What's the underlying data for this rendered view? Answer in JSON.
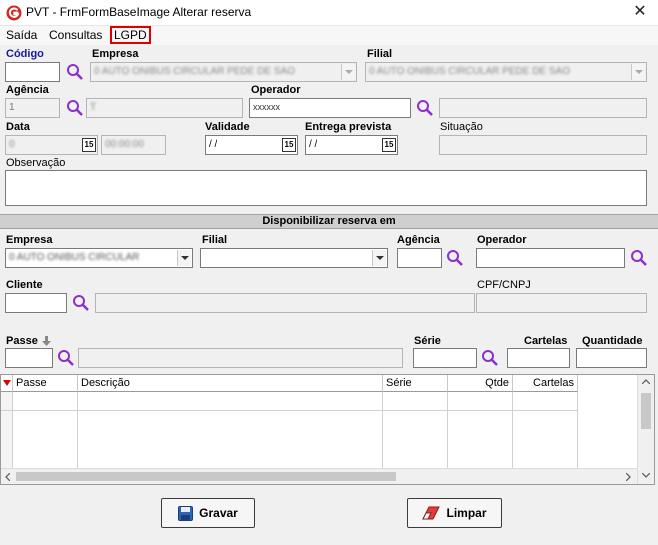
{
  "window": {
    "title": "PVT - FrmFormBaseImage Alterar reserva",
    "close_glyph": "✕"
  },
  "menu": [
    {
      "label": "Saída"
    },
    {
      "label": "Consultas"
    },
    {
      "label": "LGPD"
    }
  ],
  "top": {
    "codigo_label": "Código",
    "codigo_value": "",
    "empresa_label": "Empresa",
    "empresa_value": "0   AUTO ONIBUS CIRCULAR PEDE DE SÃO",
    "filial_label": "Filial",
    "filial_value": "0   AUTO ONIBUS CIRCULAR PEDE DE SÃO",
    "agencia_label": "Agência",
    "agencia_value": "1",
    "agencia_desc": "T",
    "operador_label": "Operador",
    "operador_value": "xxxxxx",
    "operador_desc": "",
    "data_label": "Data",
    "data_value": "0",
    "data_time": "00:00:00",
    "validade_label": "Validade",
    "validade_value": " / /",
    "entrega_label": "Entrega prevista",
    "entrega_value": " / /",
    "situacao_label": "Situação",
    "situacao_value": "",
    "observacao_label": "Observação",
    "observacao_value": ""
  },
  "disponibilizar": {
    "header": "Disponibilizar reserva em",
    "empresa_label": "Empresa",
    "empresa_value": "0   AUTO ONIBUS CIRCULAR",
    "filial_label": "Filial",
    "filial_value": "",
    "agencia_label": "Agência",
    "agencia_value": "",
    "operador_label": "Operador",
    "operador_value": "",
    "cliente_label": "Cliente",
    "cliente_value": "",
    "cliente_desc": "",
    "cpf_label": "CPF/CNPJ",
    "cpf_value": "",
    "passe_label": "Passe",
    "passe_value": "",
    "passe_desc": "",
    "serie_label": "Série",
    "serie_value": "",
    "cartelas_label": "Cartelas",
    "cartelas_value": "",
    "quantidade_label": "Quantidade",
    "quantidade_value": ""
  },
  "grid": {
    "columns": [
      "Passe",
      "Descrição",
      "Série",
      "Qtde",
      "Cartelas"
    ],
    "rows": []
  },
  "buttons": {
    "gravar_label": "Gravar",
    "limpar_label": "Limpar"
  },
  "colors": {
    "search_icon": "#8b2fc9",
    "accent_red": "#e00000",
    "label_blue": "#1a1a9a"
  }
}
